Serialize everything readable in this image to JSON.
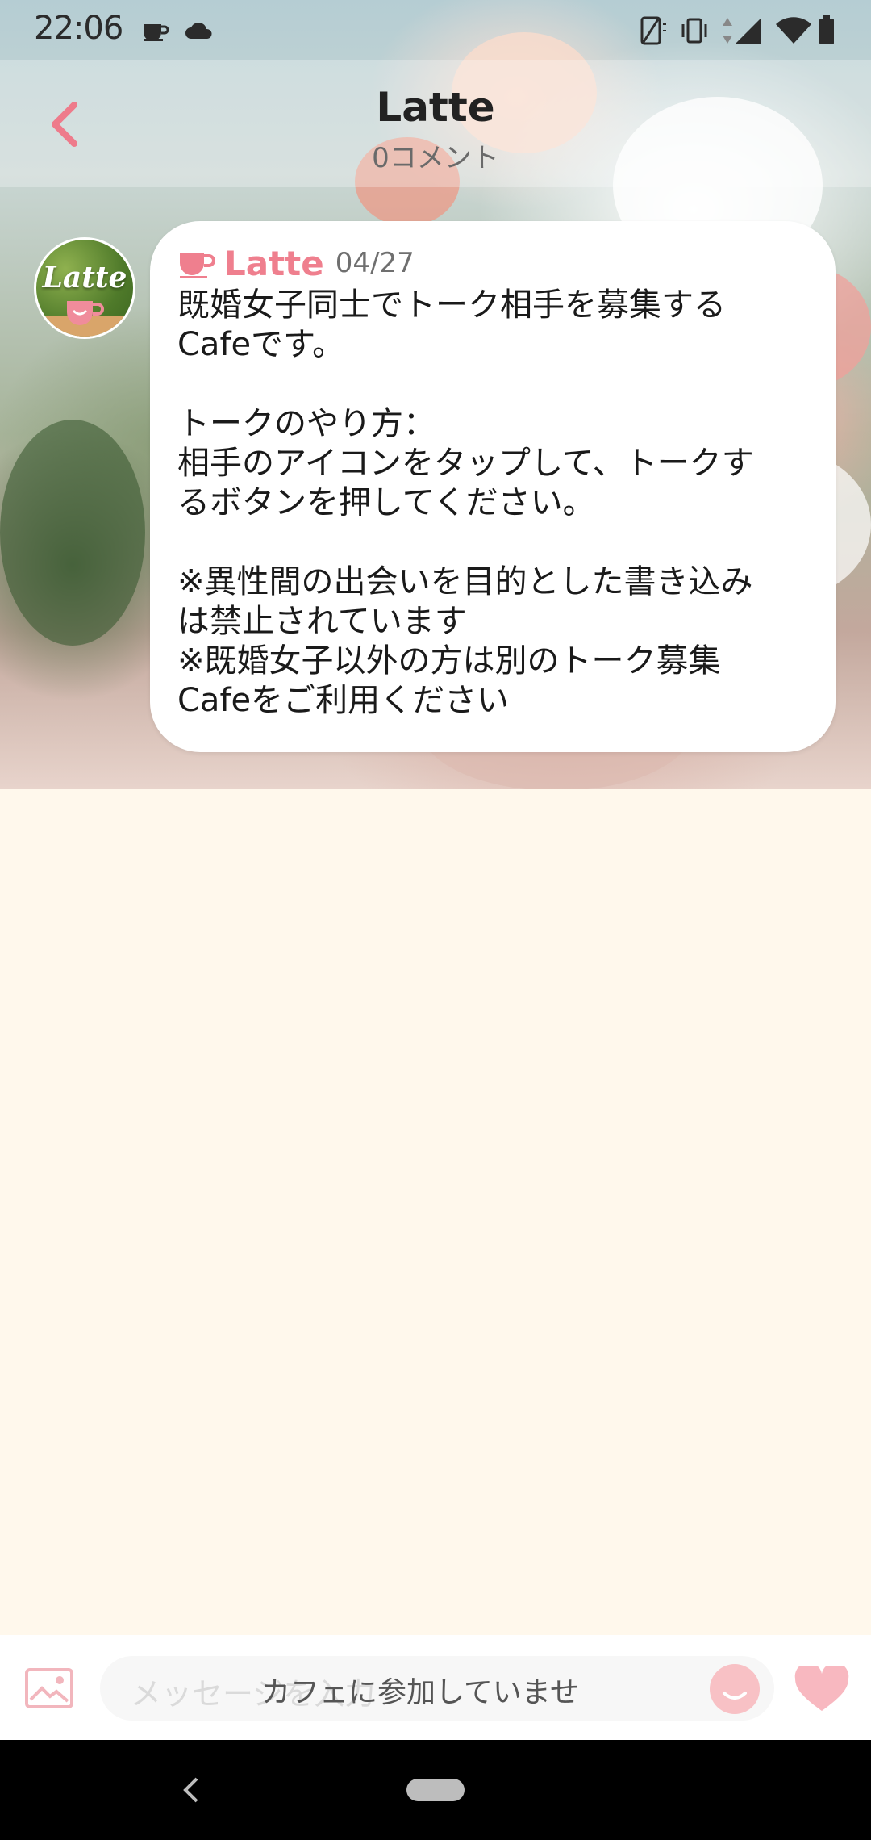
{
  "status_bar": {
    "time": "22:06",
    "notification_icons": [
      "coffee-cup-icon",
      "cloud-icon"
    ],
    "system_icons": [
      "no-sim-icon",
      "vibrate-icon",
      "data-arrows-icon",
      "signal-icon",
      "wifi-icon",
      "battery-icon"
    ]
  },
  "header": {
    "title": "Latte",
    "subtitle": "0コメント",
    "back_icon": "chevron-left-icon"
  },
  "post": {
    "avatar_text": "Latte",
    "author": "Latte",
    "date": "04/27",
    "body": "既婚女子同士でトーク相手を募集する\nCafeです。\n\nトークのやり方：\n相手のアイコンをタップして、トークす\nるボタンを押してください。\n\n※異性間の出会いを目的とした書き込み\nは禁止されています\n※既婚女子以外の方は別のトーク募集\nCafeをご利用ください"
  },
  "input_bar": {
    "placeholder": "メッセージを入力",
    "notice": "カフェに参加していませ"
  },
  "colors": {
    "accent_pink": "#ef7f8e",
    "background_cream": "#fff8ec",
    "bubble_white": "#ffffff"
  }
}
